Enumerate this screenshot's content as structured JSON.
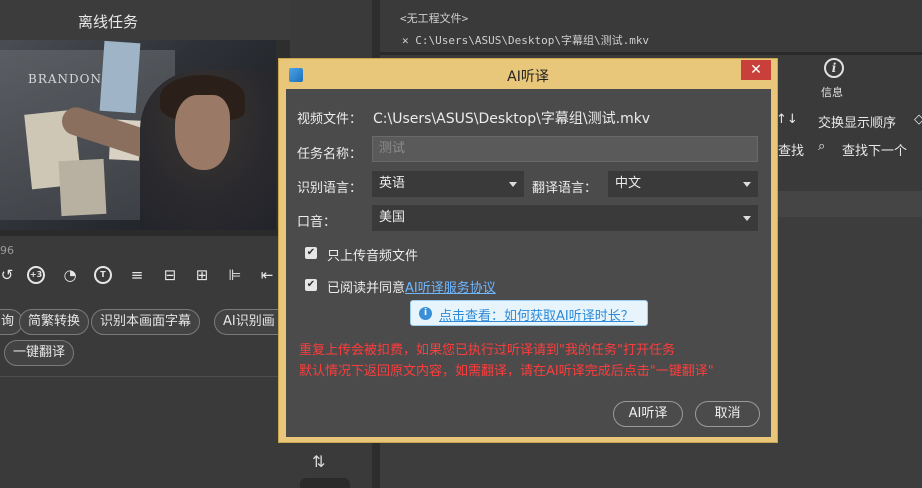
{
  "left_panel": {
    "title": "离线任务",
    "video_text": "BRANDON",
    "time_text": "96",
    "tools": [
      {
        "name": "rewind-icon",
        "glyph": "↺"
      },
      {
        "name": "forward-3-icon",
        "glyph": "+3"
      },
      {
        "name": "clock-icon",
        "glyph": "◔"
      },
      {
        "name": "text-t-icon",
        "glyph": "T"
      },
      {
        "name": "align-list-icon",
        "glyph": "≡"
      },
      {
        "name": "align-center-icon",
        "glyph": "⊟"
      },
      {
        "name": "align-vcenter-icon",
        "glyph": "⊞"
      },
      {
        "name": "align-left-icon",
        "glyph": "⊫"
      },
      {
        "name": "move-left-icon",
        "glyph": "⇤"
      }
    ],
    "buttons_row1": [
      "询",
      "简繁转换",
      "识别本画面字幕",
      "AI识别画"
    ],
    "buttons_row2": [
      "一键翻译"
    ]
  },
  "right_panel": {
    "project_title": "<无工程文件>",
    "file_tab": "C:\\Users\\ASUS\\Desktop\\字幕组\\测试.mkv",
    "info_label": "信息",
    "swap_order": "交换显示顺序",
    "find": "查找",
    "find_next": "查找下一个"
  },
  "dialog": {
    "title": "AI听译",
    "video_file_label": "视频文件：",
    "video_file_value": "C:\\Users\\ASUS\\Desktop\\字幕组\\测试.mkv",
    "task_name_label": "任务名称：",
    "task_name_placeholder": "测试",
    "recog_lang_label": "识别语言：",
    "recog_lang_value": "英语",
    "trans_lang_label": "翻译语言：",
    "trans_lang_value": "中文",
    "accent_label": "口音：",
    "accent_value": "美国",
    "audio_only_label": "只上传音频文件",
    "agree_prefix": "已阅读并同意",
    "agree_link": "AI听译服务协议",
    "tip_text": "点击查看：如何获取AI听译时长？",
    "warning_line1": "重复上传会被扣费，如果您已执行过听译请到\"我的任务\"打开任务",
    "warning_line2": "默认情况下返回原文内容，如需翻译，请在AI听译完成后点击\"一键翻译\"",
    "ok_button": "AI听译",
    "cancel_button": "取消",
    "close_glyph": "✕"
  },
  "colors": {
    "dialog_frame": "#e8c77a",
    "dialog_body": "#4b4b4b",
    "warning": "#ff3c3c",
    "link": "#6fb6ff",
    "close_button": "#c9403a"
  }
}
